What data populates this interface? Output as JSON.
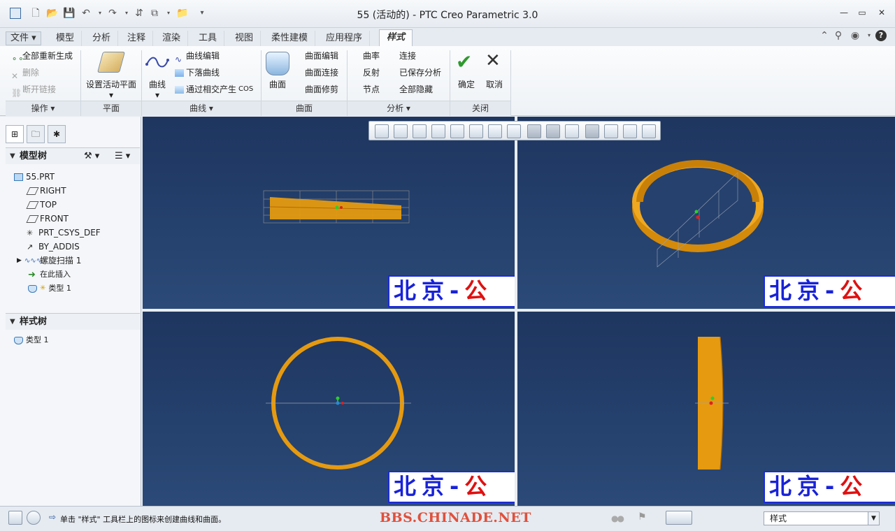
{
  "window": {
    "title": "55 (活动的) - PTC Creo Parametric 3.0"
  },
  "tabs": [
    {
      "label": "文件"
    },
    {
      "label": "模型"
    },
    {
      "label": "分析"
    },
    {
      "label": "注释"
    },
    {
      "label": "渲染"
    },
    {
      "label": "工具"
    },
    {
      "label": "视图"
    },
    {
      "label": "柔性建模"
    },
    {
      "label": "应用程序"
    },
    {
      "label": "样式"
    }
  ],
  "ribbon": {
    "operations": {
      "regenerate": "全部重新生成",
      "delete": "删除",
      "disconnect": "断开链接",
      "group": "操作"
    },
    "plane": {
      "set_active": "设置活动平面",
      "group": "平面"
    },
    "curve": {
      "curve": "曲线",
      "curve_edit": "曲线编辑",
      "drop_curve": "下落曲线",
      "cos_from_intersect": "通过相交产生",
      "cos": "COS",
      "group": "曲线"
    },
    "surface": {
      "surface": "曲面",
      "surface_edit": "曲面编辑",
      "surface_connect": "曲面连接",
      "surface_trim": "曲面修剪",
      "group": "曲面"
    },
    "analysis": {
      "curvature": "曲率",
      "connect": "连接",
      "reflect": "反射",
      "saved_analysis": "已保存分析",
      "node": "节点",
      "hide_all": "全部隐藏",
      "group": "分析"
    },
    "close": {
      "ok": "确定",
      "cancel": "取消",
      "group": "关闭"
    }
  },
  "left_panel": {
    "model_tree": {
      "title": "模型树",
      "items": [
        {
          "label": "55.PRT"
        },
        {
          "label": "RIGHT"
        },
        {
          "label": "TOP"
        },
        {
          "label": "FRONT"
        },
        {
          "label": "PRT_CSYS_DEF"
        },
        {
          "label": "BY_ADDIS"
        },
        {
          "label": "螺旋扫描 1"
        },
        {
          "label": "在此插入"
        },
        {
          "label": "类型 1"
        }
      ]
    },
    "style_tree": {
      "title": "样式树",
      "items": [
        {
          "label": "类型 1"
        }
      ]
    }
  },
  "viewport": {
    "watermark_blue": "北京-",
    "watermark_red": "公",
    "background_top": "#1e3660",
    "background_bottom": "#2c4a78",
    "model_color": "#e59a10"
  },
  "status": {
    "message": "单击 \"样式\" 工具栏上的图标来创建曲线和曲面。",
    "watermark_url": "BBS.CHINADE.NET",
    "filter_value": "样式"
  }
}
